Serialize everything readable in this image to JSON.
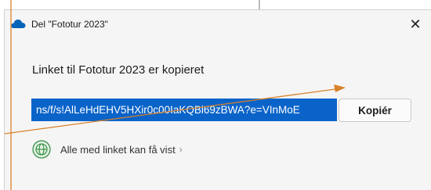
{
  "window": {
    "title": "Del \"Fototur 2023\"",
    "close_glyph": "✕"
  },
  "dialog": {
    "heading": "Linket til Fototur 2023 er kopieret",
    "link_value": "ns/f/s!AlLeHdEHV5HXir0c00IaKQBi69zBWA?e=VInMoE",
    "copy_label": "Kopiér",
    "access_label": "Alle med linket kan få vist",
    "access_chevron": "›"
  },
  "icons": {
    "app": "onedrive-cloud-icon",
    "access": "globe-icon",
    "close": "close-icon",
    "chevron": "chevron-right-icon"
  },
  "colors": {
    "accent": "#0a63c9",
    "cloud": "#0364b8",
    "annotation": "#d9822b",
    "dialog_bg": "#f5f5f5",
    "globe": "#2e8b3e"
  }
}
